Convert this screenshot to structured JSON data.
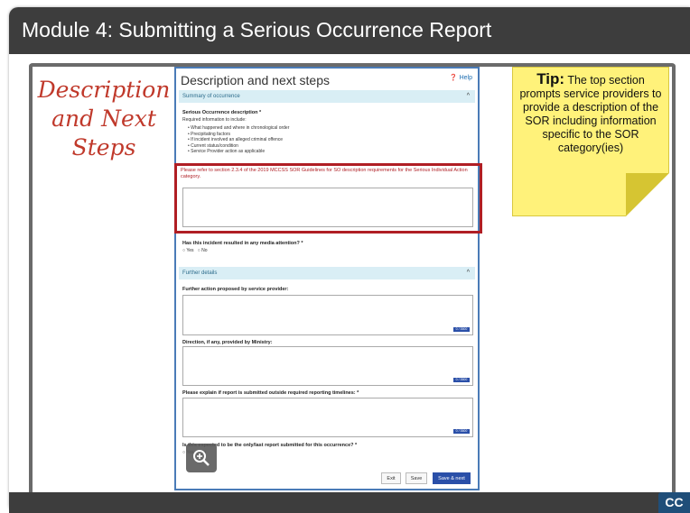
{
  "slide": {
    "title": "Module 4:  Submitting a Serious Occurrence Report",
    "handwritten": [
      "Description",
      "and Next",
      "Steps"
    ],
    "cc_label": "CC"
  },
  "form": {
    "title": "Description and next steps",
    "help": "Help",
    "summary_header": "Summary of occurrence",
    "description_label": "Serious Occurrence description *",
    "required_info": "Required information to include:",
    "bullets": [
      "What happened and where in chronological order",
      "Precipitating factors",
      "If incident involved an alleged criminal offence",
      "Current status/condition",
      "Service Provider action as applicable"
    ],
    "guideline_note": "Please refer to section 2.3.4 of the 2019 MCCSS SOR Guidelines for SO description requirements for the Serious Individual Action category.",
    "media_question": "Has this incident resulted in any media attention? *",
    "radio_yes": "Yes",
    "radio_no": "No",
    "further_header": "Further details",
    "further_action_label": "Further action proposed by service provider:",
    "direction_label": "Direction, if any, provided by Ministry:",
    "outside_timelines_label": "Please explain if report is submitted outside required reporting timelines: *",
    "counter": "0 / 3500",
    "last_report_question": "Is this expected to be the only/last report submitted for this occurrence? *",
    "exit_label": "Exit",
    "save_label": "Save",
    "save_next_label": "Save & next"
  },
  "tip": {
    "heading": "Tip:",
    "text": "The top section prompts service providers to provide a description of the SOR including information specific to the SOR category(ies)"
  },
  "colors": {
    "title_bar": "#3d3d3d",
    "handwriting": "#c0392b",
    "highlight_box": "#b01e24",
    "tip_background": "#fff27a",
    "primary_button": "#2a4fa8"
  },
  "icons": [
    "zoom-in-icon",
    "help-icon",
    "chevron-up-icon"
  ]
}
